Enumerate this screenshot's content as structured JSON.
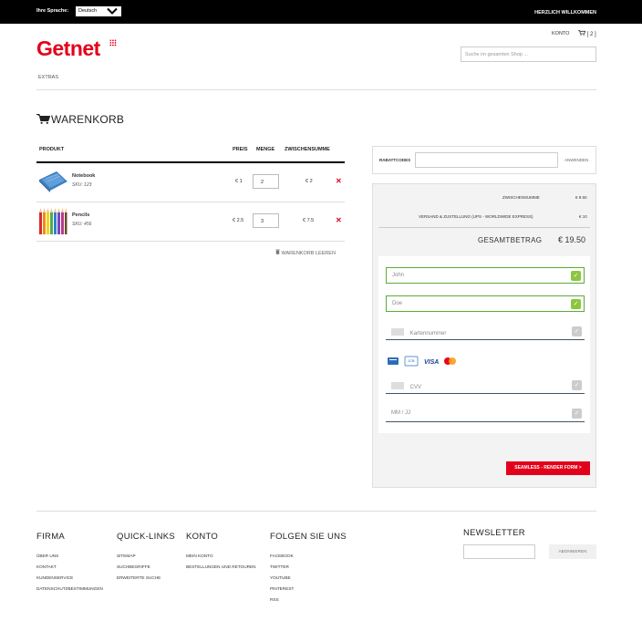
{
  "topbar": {
    "lang_label": "Ihre Sprache:",
    "lang_value": "Deutsch",
    "welcome": "HERZLICH WILLKOMMEN"
  },
  "header": {
    "logo": "Getnet",
    "konto": "KONTO",
    "cart": "[ 2 ]",
    "search_placeholder": "Suche im gesamten Shop ...",
    "nav_extras": "EXTRAS"
  },
  "cart": {
    "title": "WARENKORB",
    "columns": {
      "product": "PRODUKT",
      "price": "PREIS",
      "qty": "MENGE",
      "subtotal": "ZWISCHENSUMME"
    },
    "items": [
      {
        "name": "Notebook",
        "sku": "SKU: 123",
        "price": "€ 1",
        "qty": "2",
        "subtotal": "€ 2"
      },
      {
        "name": "Pencils",
        "sku": "SKU: 456",
        "price": "€ 2.5",
        "qty": "3",
        "subtotal": "€ 7.5"
      }
    ],
    "clear": "WARENKORB LEEREN"
  },
  "coupon": {
    "label": "RABATTCODES",
    "button": "ANWENDEN"
  },
  "summary": {
    "subtotal_label": "ZWISCHENSUMME",
    "subtotal_value": "€ 9.50",
    "shipping_label": "VERSAND & ZUSTELLUNG (UPS - WORLDWIDE EXPRESS)",
    "shipping_value": "€ 10",
    "total_label": "GESAMTBETRAG",
    "total_value": "€ 19.50"
  },
  "payment_form": {
    "first_name": "John",
    "last_name": "Doe",
    "card_placeholder": "Kartennummer",
    "cvv_placeholder": "CVV",
    "expiry_placeholder": "MM / JJ",
    "card_brands": {
      "visa": "VISA",
      "jcb": "JCB",
      "diners": "Diners"
    },
    "submit": "SEAMLESS - RENDER FORM >"
  },
  "footer": {
    "firma": {
      "title": "FIRMA",
      "links": [
        "ÜBER UNS",
        "KONTAKT",
        "KUNDENSERVICE",
        "DATENSCHUTZBESTIMMUNGEN"
      ]
    },
    "quick": {
      "title": "QUICK-LINKS",
      "links": [
        "SITEMAP",
        "SUCHBEGRIFFE",
        "ERWEITERTE SUCHE"
      ]
    },
    "konto": {
      "title": "KONTO",
      "links": [
        "MEIN KONTO",
        "BESTELLUNGEN UND RETOUREN"
      ]
    },
    "social": {
      "title": "FOLGEN SIE UNS",
      "links": [
        "FACEBOOK",
        "TWITTER",
        "YOUTUBE",
        "PINTEREST",
        "RSS"
      ]
    },
    "newsletter": {
      "title": "NEWSLETTER",
      "button": "ABONNIEREN"
    }
  },
  "colors": {
    "brand_red": "#e3001b",
    "valid_green": "#8cc63f"
  }
}
